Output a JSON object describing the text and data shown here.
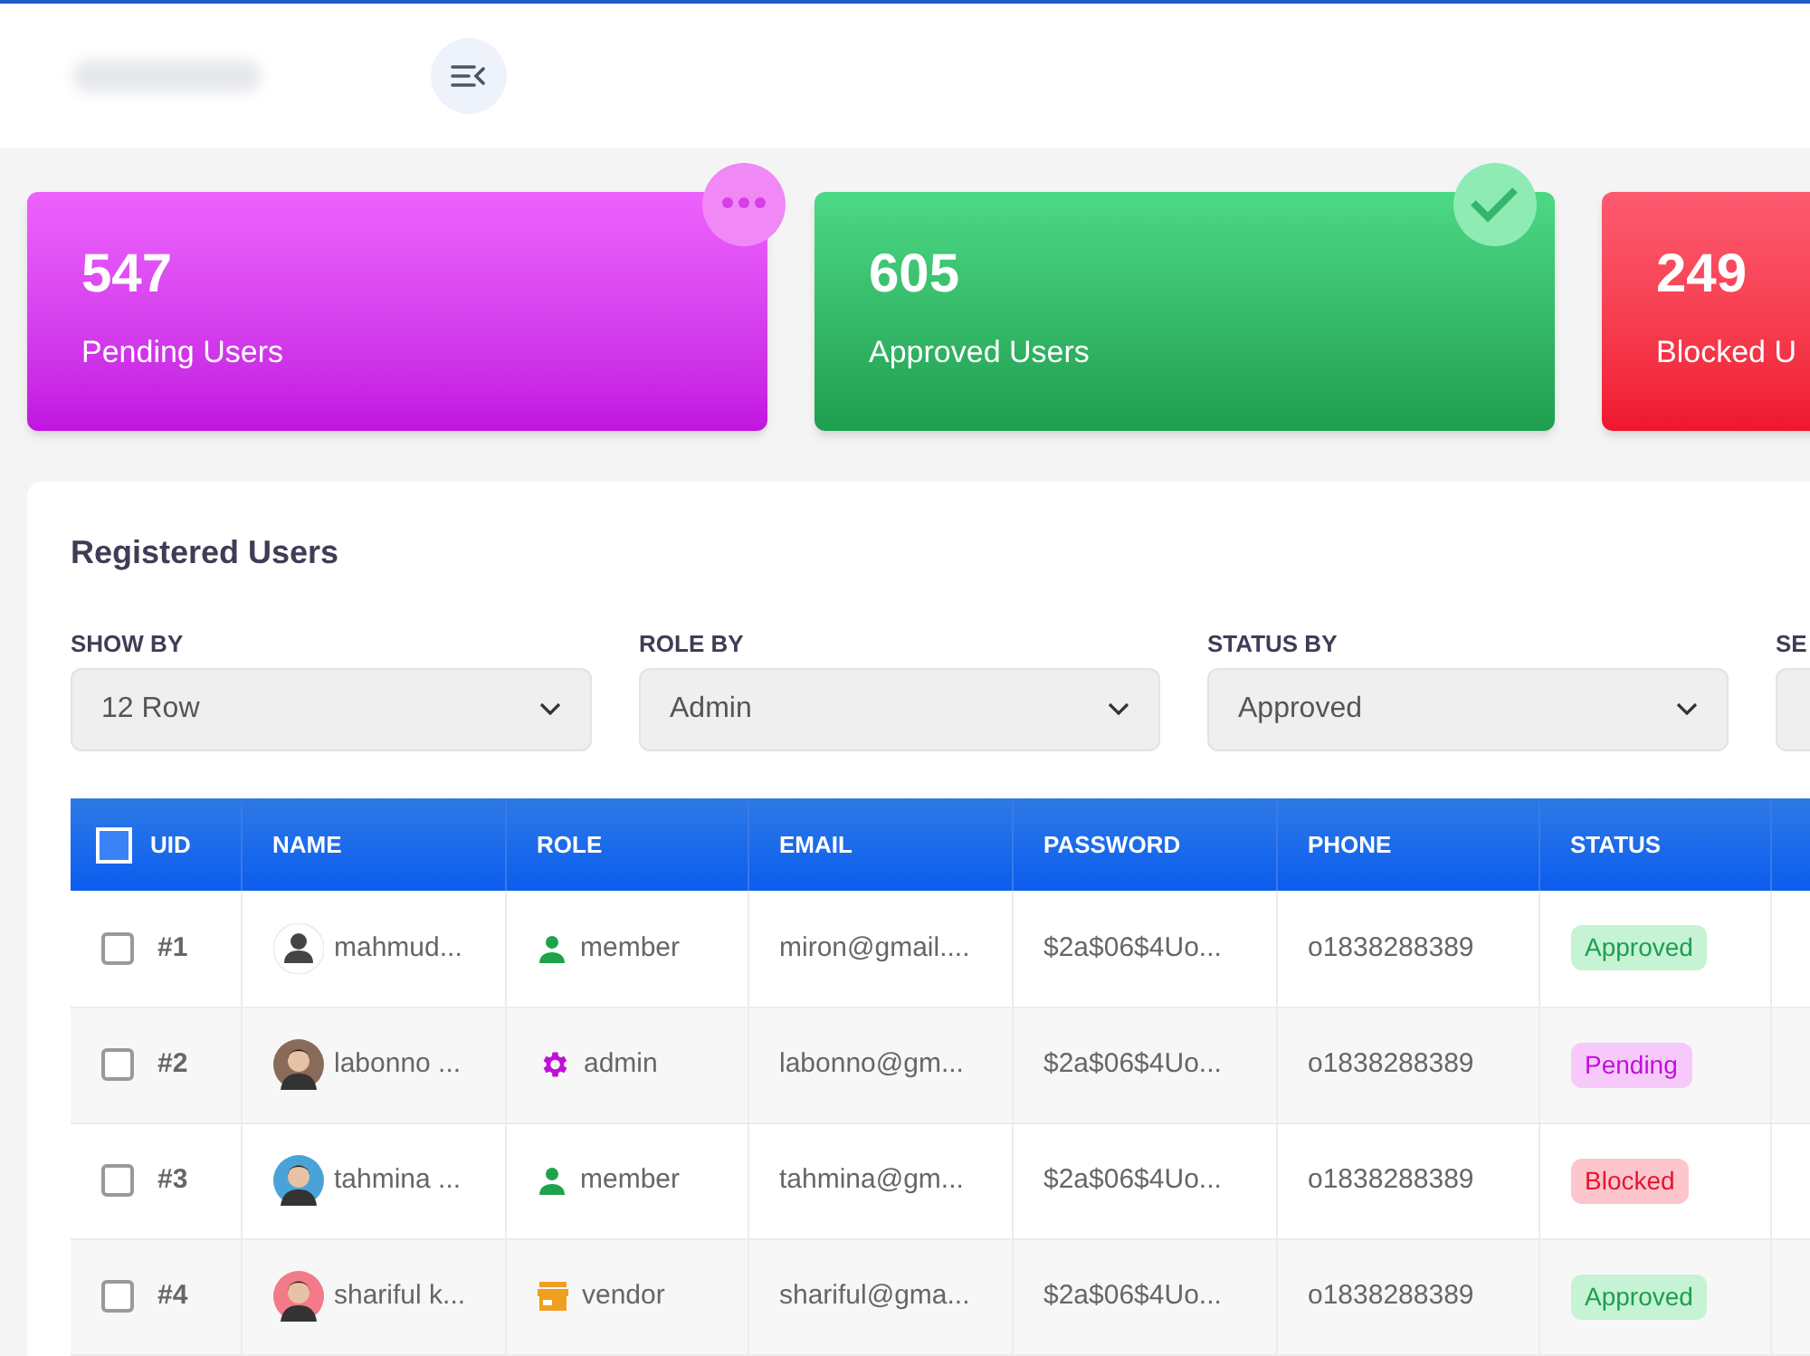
{
  "stats": [
    {
      "kind": "pending",
      "value": "547",
      "label": "Pending Users"
    },
    {
      "kind": "approved",
      "value": "605",
      "label": "Approved Users"
    },
    {
      "kind": "blocked",
      "value": "249",
      "label": "Blocked U"
    }
  ],
  "panel": {
    "title": "Registered Users",
    "filters": [
      {
        "label": "SHOW BY",
        "value": "12 Row"
      },
      {
        "label": "ROLE BY",
        "value": "Admin"
      },
      {
        "label": "STATUS BY",
        "value": "Approved"
      },
      {
        "label": "SE"
      }
    ],
    "table": {
      "all_checked": false,
      "columns": [
        "UID",
        "NAME",
        "ROLE",
        "EMAIL",
        "PASSWORD",
        "PHONE",
        "STATUS"
      ],
      "rows": [
        {
          "checked": false,
          "uid": "#1",
          "kind": "generic",
          "name": "mahmud...",
          "role": "member",
          "email": "miron@gmail....",
          "password": "$2a$06$4Uo...",
          "phone": "o1838288389",
          "status": "Approved"
        },
        {
          "checked": false,
          "uid": "#2",
          "name": "labonno ...",
          "role": "admin",
          "email": "labonno@gm...",
          "password": "$2a$06$4Uo...",
          "phone": "o1838288389",
          "status": "Pending"
        },
        {
          "checked": false,
          "uid": "#3",
          "name": "tahmina ...",
          "role": "member",
          "email": "tahmina@gm...",
          "password": "$2a$06$4Uo...",
          "phone": "o1838288389",
          "status": "Blocked"
        },
        {
          "checked": false,
          "uid": "#4",
          "name": "shariful k...",
          "role": "vendor",
          "email": "shariful@gma...",
          "password": "$2a$06$4Uo...",
          "phone": "o1838288389",
          "status": "Approved"
        }
      ]
    }
  }
}
